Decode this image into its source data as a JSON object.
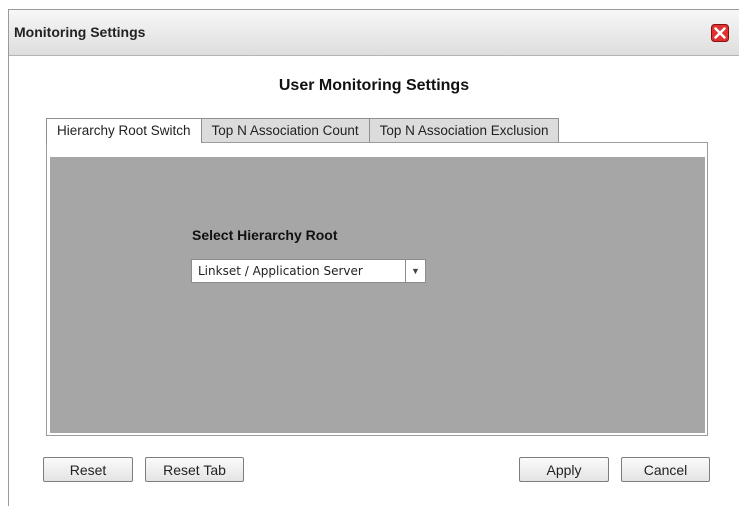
{
  "window": {
    "title": "Monitoring Settings",
    "close_icon": "close-icon"
  },
  "heading": "User Monitoring Settings",
  "tabs": [
    {
      "label": "Hierarchy Root Switch",
      "active": true
    },
    {
      "label": "Top N Association Count",
      "active": false
    },
    {
      "label": "Top N Association Exclusion",
      "active": false
    }
  ],
  "hierarchy": {
    "label": "Select Hierarchy Root",
    "selected": "Linkset / Application Server",
    "dropdown_icon": "chevron-down-icon"
  },
  "buttons": {
    "reset": "Reset",
    "reset_tab": "Reset Tab",
    "apply": "Apply",
    "cancel": "Cancel"
  },
  "colors": {
    "panel_bg": "#a6a6a6",
    "close_red": "#e03030"
  }
}
